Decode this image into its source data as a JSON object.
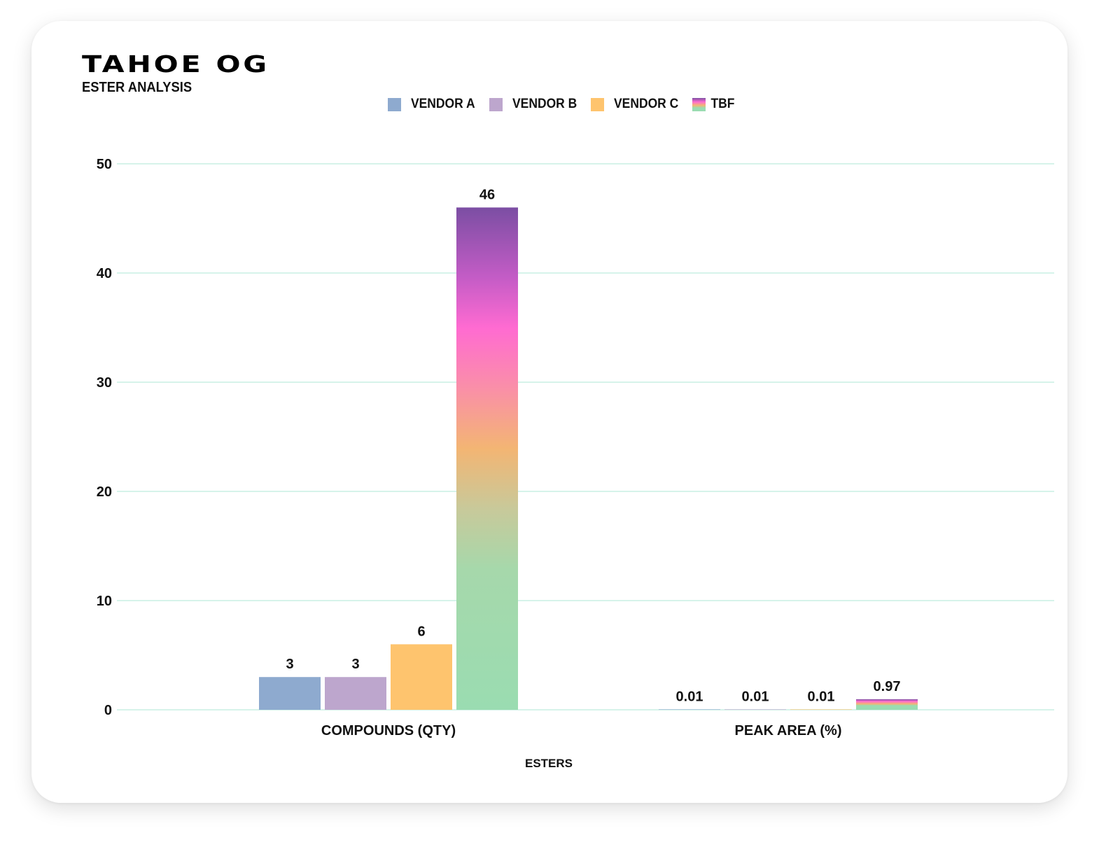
{
  "header": {
    "title": "TAHOE OG",
    "subtitle": "ESTER ANALYSIS"
  },
  "colors": {
    "vendor_a": "#8eaacf",
    "vendor_b": "#bda6cd",
    "vendor_c": "#fec46e",
    "tbf_top": "#7b4ea3",
    "tbf_pink": "#ff6bd1",
    "tbf_orange": "#f3b573",
    "tbf_green": "#9adcb1",
    "gridline": "#c9efe4"
  },
  "chart_data": {
    "type": "bar",
    "title": "TAHOE OG",
    "subtitle": "ESTER ANALYSIS",
    "xlabel": "ESTERS",
    "ylabel": "",
    "ylim": [
      0,
      50
    ],
    "yticks": [
      0,
      10,
      20,
      30,
      40,
      50
    ],
    "grid": true,
    "legend_position": "top-center",
    "categories": [
      "COMPOUNDS (QTY)",
      "PEAK AREA (%)"
    ],
    "series": [
      {
        "name": "VENDOR A",
        "values": [
          3,
          0.01
        ],
        "labels": [
          "3",
          "0.01"
        ]
      },
      {
        "name": "VENDOR B",
        "values": [
          3,
          0.01
        ],
        "labels": [
          "3",
          "0.01"
        ]
      },
      {
        "name": "VENDOR C",
        "values": [
          6,
          0.01
        ],
        "labels": [
          "6",
          "0.01"
        ]
      },
      {
        "name": "TBF",
        "values": [
          46,
          0.97
        ],
        "labels": [
          "46",
          "0.97"
        ]
      }
    ]
  }
}
